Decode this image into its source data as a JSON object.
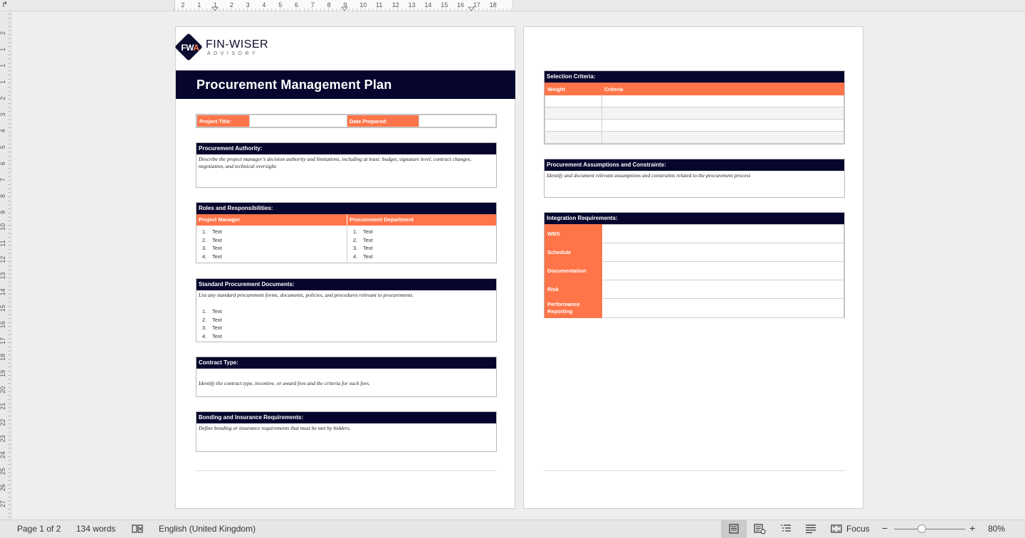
{
  "ruler": {
    "corner": "↱",
    "h_numbers": [
      "2",
      "1",
      "1",
      "2",
      "3",
      "4",
      "5",
      "6",
      "7",
      "8",
      "9",
      "10",
      "11",
      "12",
      "13",
      "14",
      "15",
      "16",
      "17",
      "18"
    ],
    "v_numbers": [
      "2",
      "1",
      "1",
      "1",
      "2",
      "3",
      "4",
      "5",
      "6",
      "7",
      "8",
      "9",
      "10",
      "11",
      "12",
      "13",
      "14",
      "15",
      "16",
      "17",
      "18",
      "19",
      "20",
      "21",
      "22",
      "23",
      "24",
      "25",
      "26",
      "27"
    ]
  },
  "logo": {
    "mark_left": "FW",
    "mark_accent": "A",
    "name": "FIN-WISER",
    "sub": "ADVISORY"
  },
  "page1": {
    "title": "Procurement Management Plan",
    "project_title_label": "Project Title:",
    "date_prepared_label": "Date Prepared:",
    "authority": {
      "heading": "Procurement Authority:",
      "desc": "Describe the project manager’s decision authority and limitations, including at least: budget, signature level, contract changes, negotiation, and technical oversight."
    },
    "roles": {
      "heading": "Roles and Responsibilities:",
      "col1": "Project Manager",
      "col2": "Procurement Department",
      "items": [
        {
          "n": "1.",
          "t": "Text"
        },
        {
          "n": "2.",
          "t": "Text"
        },
        {
          "n": "3.",
          "t": "Text"
        },
        {
          "n": "4.",
          "t": "Text"
        }
      ]
    },
    "standard_docs": {
      "heading": "Standard Procurement Documents:",
      "desc": "List any standard procurement forms, documents, policies, and procedures relevant to procurements.",
      "items": [
        {
          "n": "1.",
          "t": "Text"
        },
        {
          "n": "2.",
          "t": "Text"
        },
        {
          "n": "3.",
          "t": "Text"
        },
        {
          "n": "4.",
          "t": "Text"
        }
      ]
    },
    "contract": {
      "heading": "Contract Type:",
      "desc": "Identify the contract type, incentive, or award fees and the criteria for such fees."
    },
    "bonding": {
      "heading": "Bonding and Insurance Requirements:",
      "desc": "Define bonding or insurance requirements that must be met by bidders."
    }
  },
  "page2": {
    "selection": {
      "heading": "Selection Criteria:",
      "col1": "Weight",
      "col2": "Criteria"
    },
    "assumptions": {
      "heading": "Procurement Assumptions and Constraints:",
      "desc": "Identify and document relevant assumptions and constraints related to the procurement process"
    },
    "integration": {
      "heading": "Integration Requirements:",
      "rows": [
        "WBS",
        "Schedule",
        "Documentation",
        "Risk",
        "Performance Reporting"
      ]
    }
  },
  "status": {
    "page": "Page 1 of 2",
    "words": "134 words",
    "language": "English (United Kingdom)",
    "focus": "Focus",
    "zoom_minus": "−",
    "zoom_plus": "+",
    "zoom": "80%",
    "zoom_level": 0.8
  },
  "colors": {
    "navy": "#05052d",
    "orange": "#ff7549"
  }
}
